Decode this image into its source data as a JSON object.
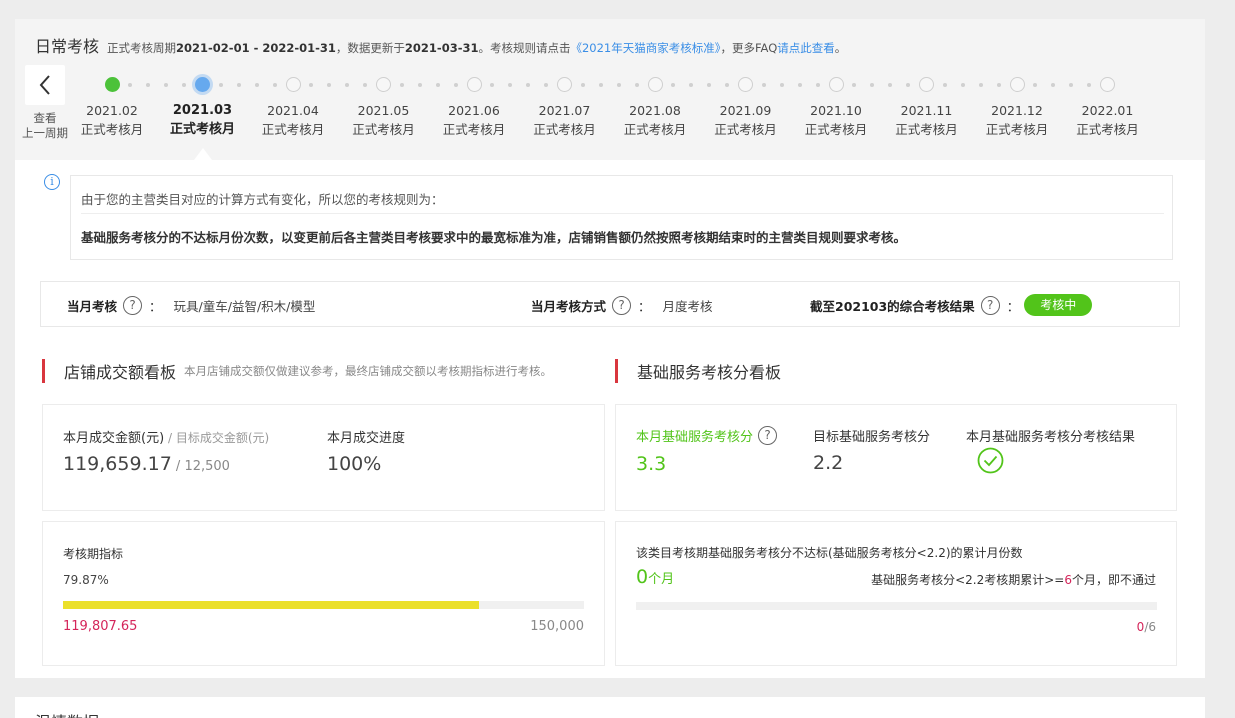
{
  "header": {
    "title": "日常考核",
    "period_prefix": "正式考核周期",
    "period": "2021-02-01 - 2022-01-31",
    "update_prefix": "，数据更新于",
    "update_date": "2021-03-31",
    "rule_prefix": "。考核规则请点击",
    "rule_link": "《2021年天猫商家考核标准》",
    "faq_prefix": "，更多FAQ",
    "faq_link": "请点此查看",
    "end": "。"
  },
  "timeline": {
    "prev_label_1": "查看",
    "prev_label_2": "上一周期",
    "months": [
      {
        "date": "2021.02",
        "label": "正式考核月",
        "status": "done"
      },
      {
        "date": "2021.03",
        "label": "正式考核月",
        "status": "current"
      },
      {
        "date": "2021.04",
        "label": "正式考核月",
        "status": "future"
      },
      {
        "date": "2021.05",
        "label": "正式考核月",
        "status": "future"
      },
      {
        "date": "2021.06",
        "label": "正式考核月",
        "status": "future"
      },
      {
        "date": "2021.07",
        "label": "正式考核月",
        "status": "future"
      },
      {
        "date": "2021.08",
        "label": "正式考核月",
        "status": "future"
      },
      {
        "date": "2021.09",
        "label": "正式考核月",
        "status": "future"
      },
      {
        "date": "2021.10",
        "label": "正式考核月",
        "status": "future"
      },
      {
        "date": "2021.11",
        "label": "正式考核月",
        "status": "future"
      },
      {
        "date": "2021.12",
        "label": "正式考核月",
        "status": "future"
      },
      {
        "date": "2022.01",
        "label": "正式考核月",
        "status": "future"
      }
    ]
  },
  "notice": {
    "icon_glyph": "i",
    "line1": "由于您的主营类目对应的计算方式有变化，所以您的考核规则为：",
    "line2": "基础服务考核分的不达标月份次数，以变更前后各主营类目考核要求中的最宽标准为准，店铺销售额仍然按照考核期结束时的主营类目规则要求考核。"
  },
  "exam": {
    "category_label": "当月考核",
    "category_value": "玩具/童车/益智/积木/模型",
    "method_label": "当月考核方式",
    "method_value": "月度考核",
    "result_label": "截至202103的综合考核结果",
    "result_badge": "考核中",
    "colon": "：",
    "q": "?"
  },
  "sales": {
    "title": "店铺成交额看板",
    "hint": "本月店铺成交额仅做建议参考，最终店铺成交额以考核期指标进行考核。",
    "amount_label": "本月成交金额(元)",
    "target_sep": " / ",
    "target_label": "目标成交金额(元)",
    "amount_value": "119,659.17",
    "target_value": "12,500",
    "progress_label": "本月成交进度",
    "progress_value": "100%",
    "period_label": "考核期指标",
    "period_percent": "79.87%",
    "period_progress": 0.7987,
    "period_current": "119,807.65",
    "period_target": "150,000"
  },
  "service": {
    "title": "基础服务考核分看板",
    "score_label": "本月基础服务考核分",
    "score_value": "3.3",
    "target_label": "目标基础服务考核分",
    "target_value": "2.2",
    "result_label": "本月基础服务考核分考核结果",
    "fail_title": "该类目考核期基础服务考核分不达标(基础服务考核分<2.2)的累计月份数",
    "fail_count": "0",
    "fail_unit": "个月",
    "rule_prefix": "基础服务考核分<2.2考核期累计>=",
    "rule_num": "6",
    "rule_suffix": "个月，即不通过",
    "fail_progress": 0,
    "ratio_num": "0",
    "ratio_den": "/6"
  },
  "bottom": {
    "title": "温情数据"
  },
  "colors": {
    "accent_green": "#52c41a",
    "current_blue": "#66a9ee",
    "link_blue": "#3a8ee6",
    "progress_yellow": "#ebe02a",
    "red_bar": "#d9363e",
    "pink_value": "#d4255a"
  }
}
